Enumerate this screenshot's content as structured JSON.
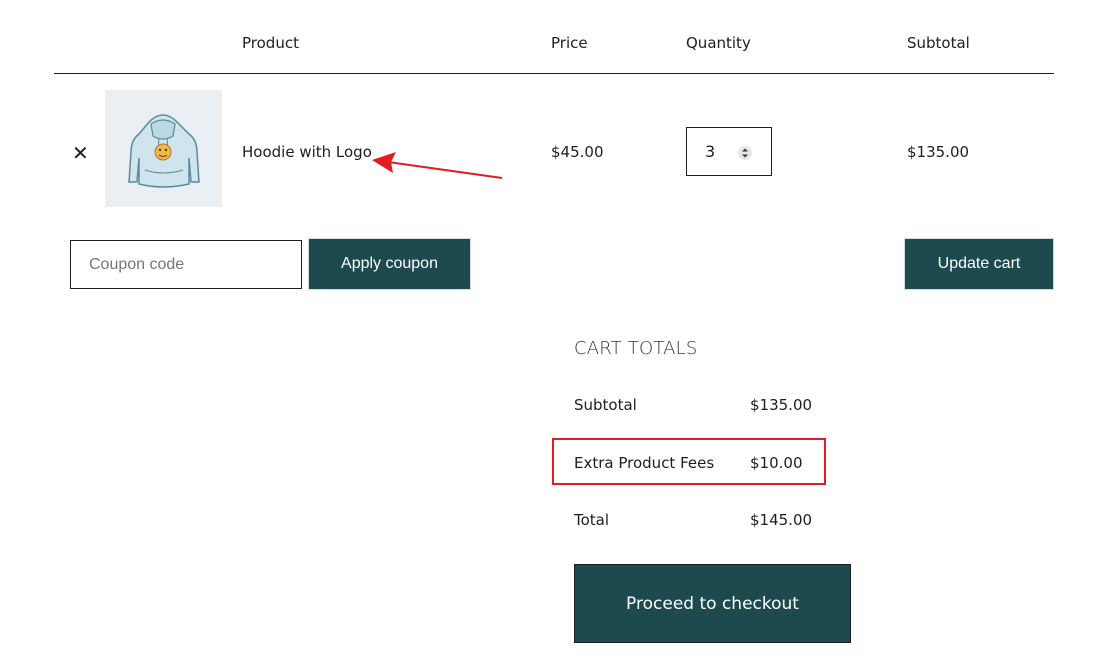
{
  "table_header": {
    "product": "Product",
    "price": "Price",
    "quantity": "Quantity",
    "subtotal": "Subtotal"
  },
  "cart_item": {
    "remove_symbol": "✕",
    "thumbnail_icon": "hoodie-image",
    "name": "Hoodie with Logo",
    "price": "$45.00",
    "quantity": "3",
    "subtotal": "$135.00"
  },
  "coupon": {
    "placeholder": "Coupon code",
    "value": "",
    "apply_label": "Apply coupon"
  },
  "update_cart_label": "Update cart",
  "cart_totals": {
    "title": "CART TOTALS",
    "rows": [
      {
        "label": "Subtotal",
        "value": "$135.00"
      },
      {
        "label": "Extra Product Fees",
        "value": "$10.00"
      },
      {
        "label": "Total",
        "value": "$145.00"
      }
    ],
    "checkout_label": "Proceed to checkout"
  },
  "annotation": {
    "highlight_color": "#e31b23",
    "arrow_color": "#e31b23"
  },
  "colors": {
    "button_bg": "#1c4a4e",
    "text": "#1e1e1e"
  }
}
